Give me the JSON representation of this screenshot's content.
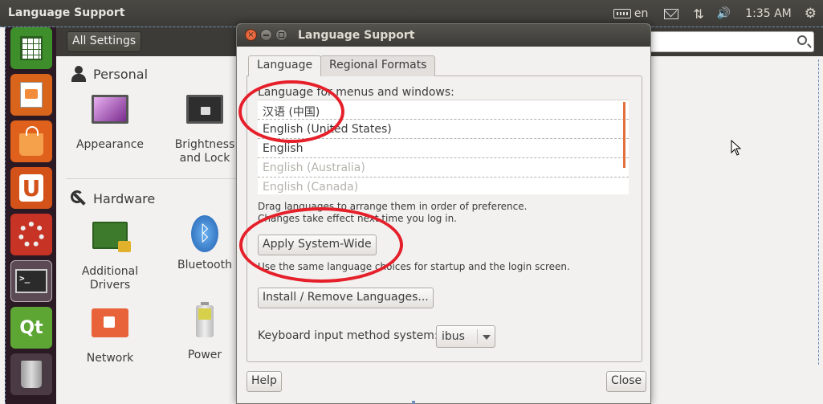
{
  "top_panel": {
    "title": "Language Support",
    "keyboard_indicator": "en",
    "time": "1:35 AM"
  },
  "settings": {
    "all_settings_label": "All Settings",
    "personal_section": "Personal",
    "hardware_section": "Hardware",
    "personal_items": [
      {
        "label": "Appearance"
      },
      {
        "label": "Brightness and Lock"
      }
    ],
    "hardware_items": [
      {
        "label": "Additional Drivers"
      },
      {
        "label": "Bluetooth"
      },
      {
        "label": "Network"
      },
      {
        "label": "Power"
      }
    ]
  },
  "dialog": {
    "title": "Language Support",
    "tabs": [
      {
        "label": "Language",
        "active": true
      },
      {
        "label": "Regional Formats",
        "active": false
      }
    ],
    "list_label": "Language for menus and windows:",
    "languages": [
      {
        "label": "汉语 (中国)",
        "enabled": true
      },
      {
        "label": "English (United States)",
        "enabled": true
      },
      {
        "label": "English",
        "enabled": true
      },
      {
        "label": "English (Australia)",
        "enabled": false
      },
      {
        "label": "English (Canada)",
        "enabled": false
      }
    ],
    "drag_hint_line1": "Drag languages to arrange them in order of preference.",
    "drag_hint_line2": "Changes take effect next time you log in.",
    "apply_button": "Apply System-Wide",
    "apply_hint": "Use the same language choices for startup and the login screen.",
    "install_button": "Install / Remove Languages...",
    "input_method_label": "Keyboard input method system:",
    "input_method_value": "ibus",
    "help_button": "Help",
    "close_button": "Close"
  },
  "colors": {
    "annotation": "#e5202a",
    "panel": "#3c3b37",
    "launcher": "#2b1a24",
    "accent": "#e1703e"
  },
  "icons": {
    "keyboard": "keyboard-icon",
    "mail": "mail-icon",
    "network": "network-arrows-icon",
    "volume": "volume-icon",
    "power": "gear-icon"
  }
}
